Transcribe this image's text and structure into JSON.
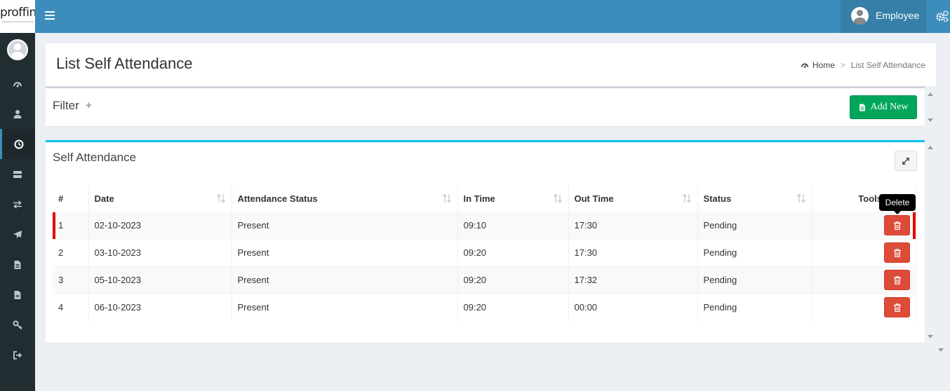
{
  "logo": {
    "text": "proffin"
  },
  "topbar": {
    "user_name": "Employee"
  },
  "page": {
    "title": "List Self Attendance"
  },
  "breadcrumb": {
    "home": "Home",
    "separator": ">",
    "current": "List Self Attendance"
  },
  "filter": {
    "title": "Filter",
    "toggle": "+",
    "add_button": "Add New"
  },
  "attendance": {
    "title": "Self Attendance",
    "columns": [
      "#",
      "Date",
      "Attendance Status",
      "In Time",
      "Out Time",
      "Status",
      "Tools"
    ],
    "rows": [
      {
        "no": "1",
        "date": "02-10-2023",
        "attendance_status": "Present",
        "in_time": "09:10",
        "out_time": "17:30",
        "status": "Pending"
      },
      {
        "no": "2",
        "date": "03-10-2023",
        "attendance_status": "Present",
        "in_time": "09:20",
        "out_time": "17:30",
        "status": "Pending"
      },
      {
        "no": "3",
        "date": "05-10-2023",
        "attendance_status": "Present",
        "in_time": "09:20",
        "out_time": "17:32",
        "status": "Pending"
      },
      {
        "no": "4",
        "date": "06-10-2023",
        "attendance_status": "Present",
        "in_time": "09:20",
        "out_time": "00:00",
        "status": "Pending"
      }
    ],
    "tooltip": "Delete"
  },
  "sidebar": {
    "items": [
      {
        "icon": "dashboard-icon"
      },
      {
        "icon": "user-icon"
      },
      {
        "icon": "clock-icon",
        "active": true
      },
      {
        "icon": "card-icon"
      },
      {
        "icon": "exchange-icon"
      },
      {
        "icon": "plane-icon"
      },
      {
        "icon": "document-icon"
      },
      {
        "icon": "file-icon"
      },
      {
        "icon": "key-icon"
      },
      {
        "icon": "sign-out-icon"
      }
    ]
  },
  "colors": {
    "topbar": "#3c8dbc",
    "sidebar": "#222d32",
    "add_button": "#00a65a",
    "delete_button": "#dd4b39",
    "box_accent": "#00c0ef"
  }
}
